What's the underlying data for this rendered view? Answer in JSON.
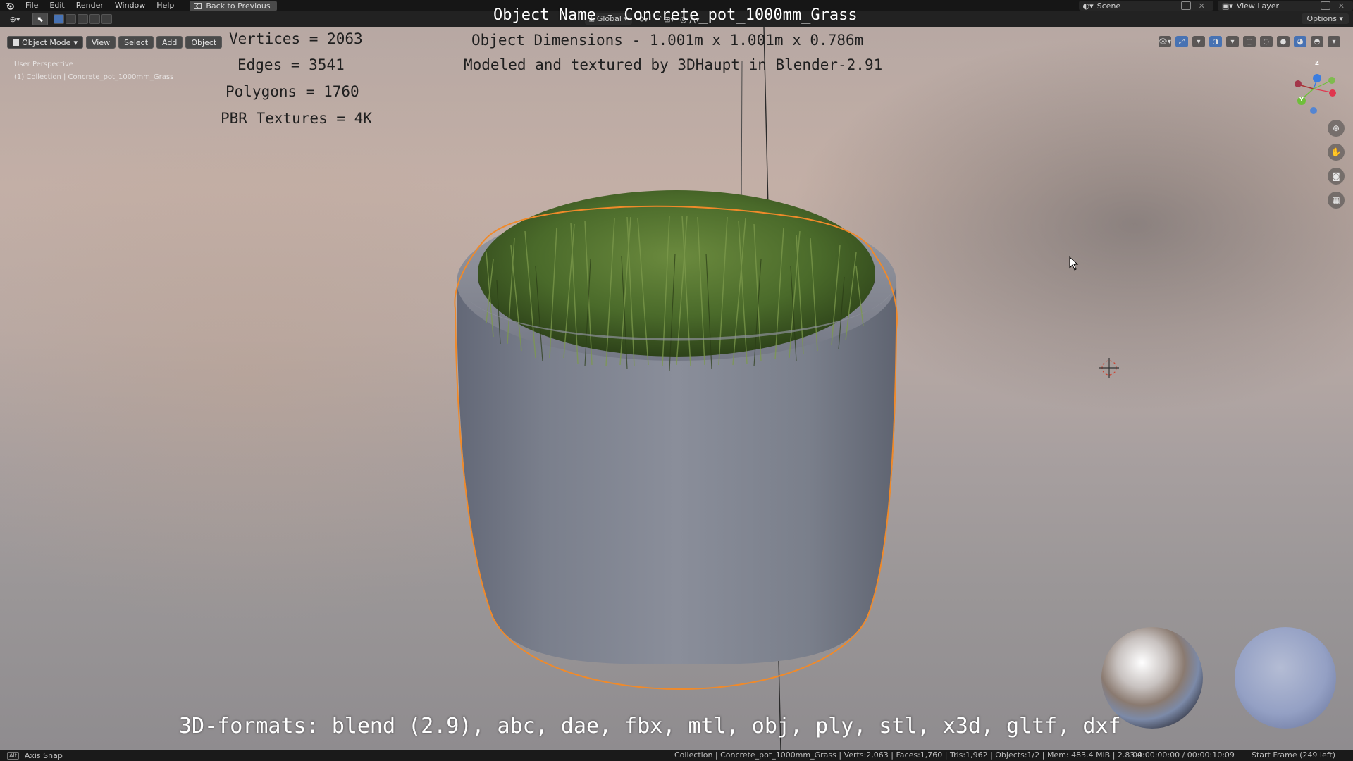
{
  "menubar": {
    "items": [
      "File",
      "Edit",
      "Render",
      "Window",
      "Help"
    ],
    "back_button": "Back to Previous",
    "scene_label": "Scene",
    "view_layer_label": "View Layer"
  },
  "header": {
    "transform_orientation": "Global",
    "options_label": "Options"
  },
  "viewport_header": {
    "mode": "Object Mode",
    "menus": [
      "View",
      "Select",
      "Add",
      "Object"
    ]
  },
  "viewport": {
    "perspective_label": "User Perspective",
    "collection_label": "(1) Collection | Concrete_pot_1000mm_Grass"
  },
  "overlay": {
    "title": "Object Name - Concrete_pot_1000mm_Grass",
    "dimensions": "Object Dimensions -  1.001m x 1.001m x 0.786m",
    "credits": "Modeled and textured by 3DHaupt in Blender-2.91",
    "stats": [
      "Vertices = 2063",
      "Edges = 3541",
      "Polygons = 1760",
      "PBR Textures = 4K"
    ],
    "formats": "3D-formats: blend (2.9), abc, dae, fbx, mtl, obj, ply, stl, x3d, gltf, dxf"
  },
  "gizmo": {
    "z_label": "Z",
    "y_label": "Y",
    "x_color": "#e0364e",
    "y_color": "#6fbf3a",
    "z_color": "#3b7de0"
  },
  "statusbar": {
    "key": "Alt",
    "hint": "Axis Snap",
    "stats": "Collection | Concrete_pot_1000mm_Grass | Verts:2,063 | Faces:1,760 | Tris:1,962 | Objects:1/2 | Mem: 483.4 MiB | 2.83.4",
    "time": "00:00:00:00 / 00:00:10:09",
    "frame": "Start Frame (249 left)"
  },
  "colors": {
    "selection_outline": "#f08a2a",
    "active_blue": "#4772b3",
    "pot_gray": "#767b89",
    "grass_green": "#4b6b2c"
  }
}
